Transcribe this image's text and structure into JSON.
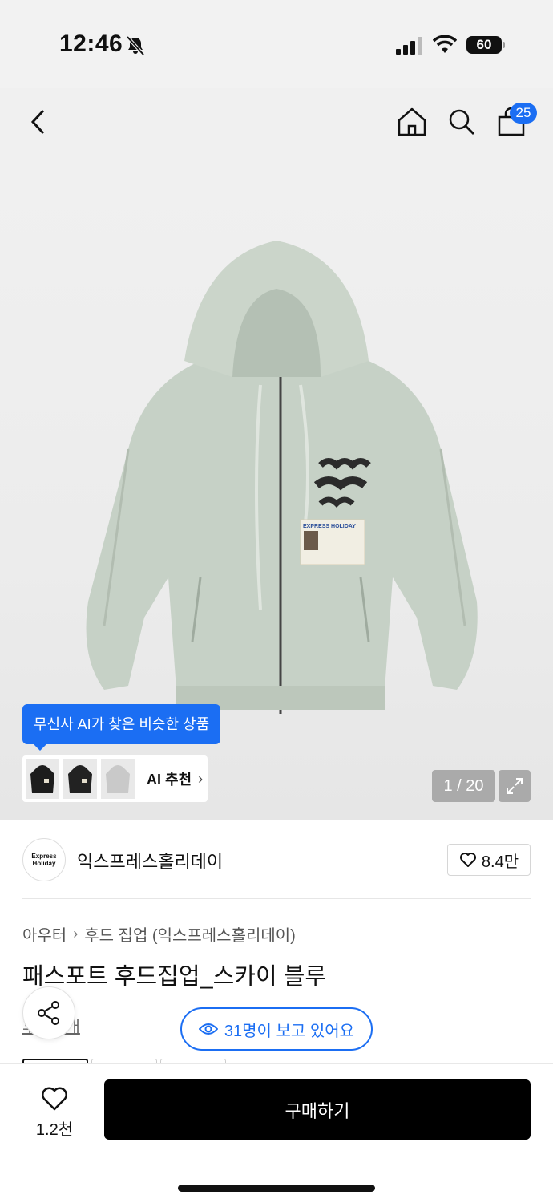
{
  "status_bar": {
    "time": "12:46",
    "battery": "60"
  },
  "nav": {
    "cart_count": "25"
  },
  "hero": {
    "ai_tooltip": "무신사 AI가 찾은 비슷한 상품",
    "ai_label": "AI 추천",
    "page_indicator": "1 / 20",
    "print_text": "EXPRESS HOLIDAY"
  },
  "brand": {
    "name": "익스프레스홀리데이",
    "logo_line1": "Express",
    "logo_line2": "Holiday",
    "likes": "8.4만"
  },
  "product": {
    "breadcrumb": [
      "아우터",
      "후드 집업 (익스프레스홀리데이)"
    ],
    "title": "패스포트 후드집업_스카이 블루",
    "reviews_partial": "후기 5개",
    "viewers": "31명이 보고 있어요"
  },
  "bottom": {
    "wish_count": "1.2천",
    "buy_label": "구매하기"
  },
  "colors": {
    "accent": "#1b6ef3",
    "buy_button": "#000000",
    "hoodie": "#c6d1c6"
  }
}
